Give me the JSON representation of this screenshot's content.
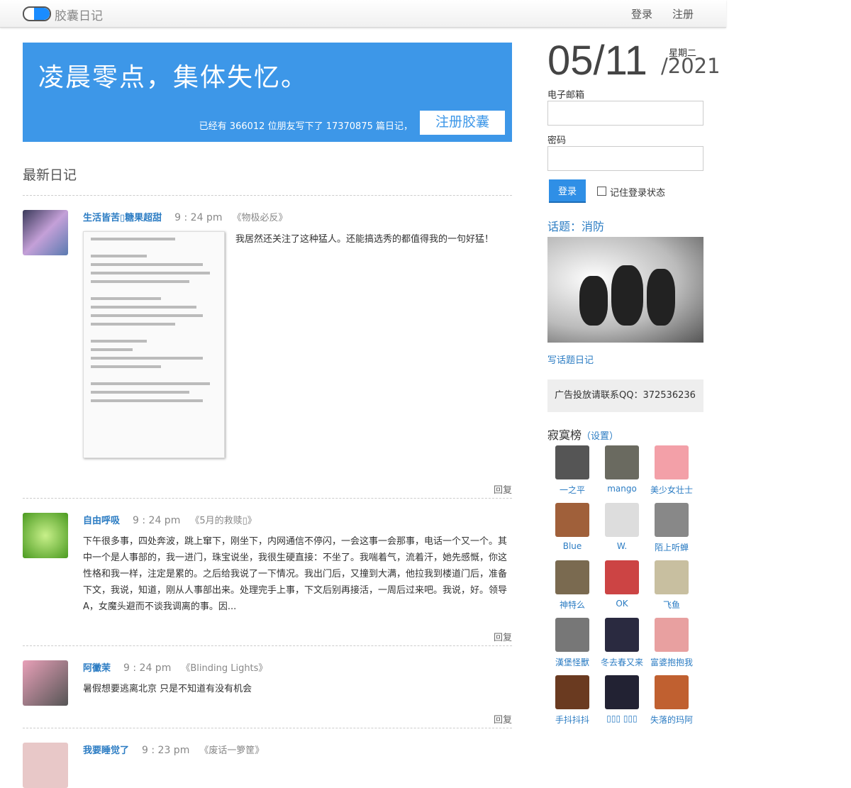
{
  "header": {
    "brand": "胶囊日记",
    "login": "登录",
    "register": "注册"
  },
  "banner": {
    "slogan": "凌晨零点，集体失忆。",
    "stats": "已经有 366012 位朋友写下了 17370875 篇日记，",
    "register_button": "注册胶囊"
  },
  "section_title": "最新日记",
  "entries": [
    {
      "user": "生活皆苦▯糖果超甜",
      "time": "9 : 24 pm",
      "title": "《物极必反》",
      "content": "我居然还关注了这种猛人。还能搞选秀的都值得我的一句好猛！",
      "reply": "回复",
      "avatar_color": "#9b8fb8"
    },
    {
      "user": "自由呼吸",
      "time": "9 : 24 pm",
      "title": "《5月的救赎▯》",
      "content": "下午很多事，四处奔波，跳上窜下，刚坐下，内网通信不停闪，一会这事一会那事，电话一个又一个。其中一个是人事部的，我一进门，珠宝说坐，我很生硬直接：不坐了。我喘着气，流着汗，她先感慨，你这性格和我一样，注定是累的。之后给我说了一下情况。我出门后，又撞到大满，他拉我到楼道门后，准备下文，我说，知道，刚从人事部出来。处理完手上事，下文后别再接活，一周后过来吧。我说，好。领导A，女魔头避而不谈我调离的事。因...",
      "reply": "回复",
      "avatar_color": "#7fc24a"
    },
    {
      "user": "阿黴茉",
      "time": "9 : 24 pm",
      "title": "《Blinding Lights》",
      "content": "暑假想要逃离北京 只是不知道有没有机会",
      "reply": "回复",
      "avatar_color": "#d98fa5"
    },
    {
      "user": "我要睡觉了",
      "time": "9 : 23 pm",
      "title": "《废话一箩筐》",
      "avatar_color": "#e8c8c8"
    }
  ],
  "sidebar": {
    "date": "05/11",
    "weekday": "星期二",
    "year": "/2021",
    "email_label": "电子邮箱",
    "password_label": "密码",
    "login_button": "登录",
    "remember": "记住登录状态",
    "topic": "话题：消防",
    "topic_link": "写话题日记",
    "ad": "广告投放请联系QQ：372536236",
    "lonely_title": "寂寞榜",
    "lonely_settings": "（设置）",
    "users": [
      {
        "name": "一之平",
        "color": "#555"
      },
      {
        "name": "mango",
        "color": "#6a6a60"
      },
      {
        "name": "美少女壮士",
        "color": "#f3a0a8"
      },
      {
        "name": "Blue",
        "color": "#a0603a"
      },
      {
        "name": "W.",
        "color": "#ddd"
      },
      {
        "name": "陌上听蝉",
        "color": "#888"
      },
      {
        "name": "神特么",
        "color": "#7a6a50"
      },
      {
        "name": "OK",
        "color": "#c44"
      },
      {
        "name": "飞鱼",
        "color": "#c8bfa0"
      },
      {
        "name": "漢堡怪獸",
        "color": "#777"
      },
      {
        "name": "冬去春又来",
        "color": "#2a2a40"
      },
      {
        "name": "富婆抱抱我",
        "color": "#e8a0a0"
      },
      {
        "name": "手抖抖抖",
        "color": "#6a3a20"
      },
      {
        "name": "▯▯▯ ▯▯▯",
        "color": "#223"
      },
      {
        "name": "失落的玛阿",
        "color": "#c06030"
      }
    ]
  }
}
